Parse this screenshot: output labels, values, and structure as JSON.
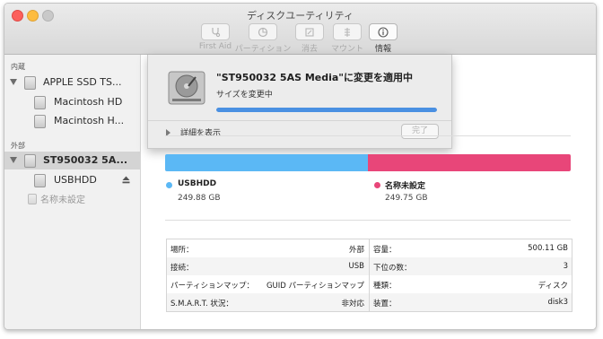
{
  "window": {
    "title": "ディスクユーティリティ"
  },
  "colors": {
    "close": "#fc605c",
    "minimize": "#fdbc40",
    "zoom": "#c9c9c9",
    "accent": "#4a90e2",
    "volume_usb": "#5bb8f5",
    "volume_free": "#e84679"
  },
  "toolbar": {
    "first_aid": {
      "label": "First Aid",
      "icon": "stethoscope-icon"
    },
    "partition": {
      "label": "パーティション",
      "icon": "pie-icon"
    },
    "erase": {
      "label": "消去",
      "icon": "erase-icon"
    },
    "mount": {
      "label": "マウント",
      "icon": "mount-icon"
    },
    "info": {
      "label": "情報",
      "icon": "info-icon"
    }
  },
  "sidebar": {
    "internal_header": "内蔵",
    "internal_disk": "APPLE SSD TS...",
    "internal_volumes": [
      "Macintosh HD",
      "Macintosh H..."
    ],
    "external_header": "外部",
    "external_disk": "ST950032 5A...",
    "external_volumes": [
      "USBHDD",
      "名称未設定"
    ],
    "eject_icon": "eject-icon"
  },
  "sheet": {
    "title": "\"ST950032 5AS Media\"に変更を適用中",
    "status": "サイズを変更中",
    "progress": 1.0,
    "details_label": "詳細を表示",
    "done_label": "完了"
  },
  "volumes": [
    {
      "name": "USBHDD",
      "size": "249.88 GB",
      "share": 0.5,
      "color": "#5bb8f5"
    },
    {
      "name": "名称未設定",
      "size": "249.75 GB",
      "share": 0.5,
      "color": "#e84679"
    }
  ],
  "info": {
    "rows": [
      {
        "l_label": "場所：",
        "l_value": "外部",
        "r_label": "容量：",
        "r_value": "500.11 GB"
      },
      {
        "l_label": "接続：",
        "l_value": "USB",
        "r_label": "下位の数：",
        "r_value": "3"
      },
      {
        "l_label": "パーティションマップ：",
        "l_value": "GUID パーティションマップ",
        "r_label": "種類：",
        "r_value": "ディスク"
      },
      {
        "l_label": "S.M.A.R.T. 状況：",
        "l_value": "非対応",
        "r_label": "装置：",
        "r_value": "disk3"
      }
    ]
  }
}
